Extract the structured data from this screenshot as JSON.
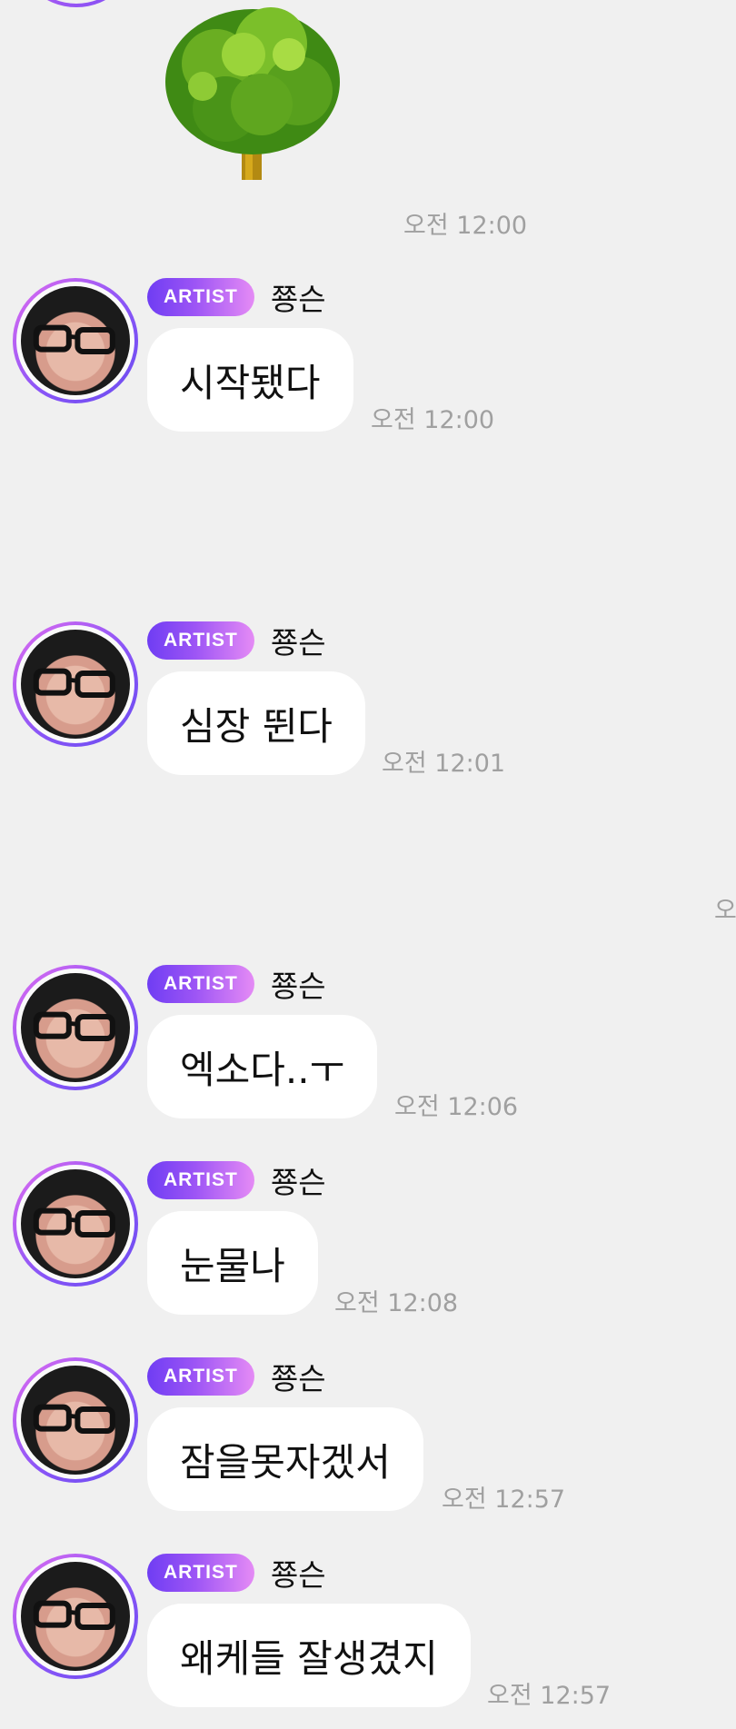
{
  "top": {
    "tree_emoji": "🌳",
    "time": "오전 12:00"
  },
  "messages": [
    {
      "badge": "ARTIST",
      "name": "쭁슨",
      "text": "시작됐다",
      "time": "오전 12:00"
    },
    {
      "badge": "ARTIST",
      "name": "쭁슨",
      "text": "심장 뛴다",
      "time": "오전 12:01"
    },
    {
      "badge": "ARTIST",
      "name": "쭁슨",
      "text": "엑소다..ㅜ",
      "time": "오전 12:06"
    },
    {
      "badge": "ARTIST",
      "name": "쭁슨",
      "text": "눈물나",
      "time": "오전 12:08"
    },
    {
      "badge": "ARTIST",
      "name": "쭁슨",
      "text": "잠을못자겠서",
      "time": "오전 12:57"
    },
    {
      "badge": "ARTIST",
      "name": "쭁슨",
      "text": "왜케들 잘생겼지",
      "time": "오전 12:57"
    }
  ],
  "edge_text": "오",
  "colors": {
    "background": "#f0f0f0",
    "badge_start": "#6f3df3",
    "badge_end": "#e58bf5",
    "timestamp": "#a0a0a0"
  }
}
